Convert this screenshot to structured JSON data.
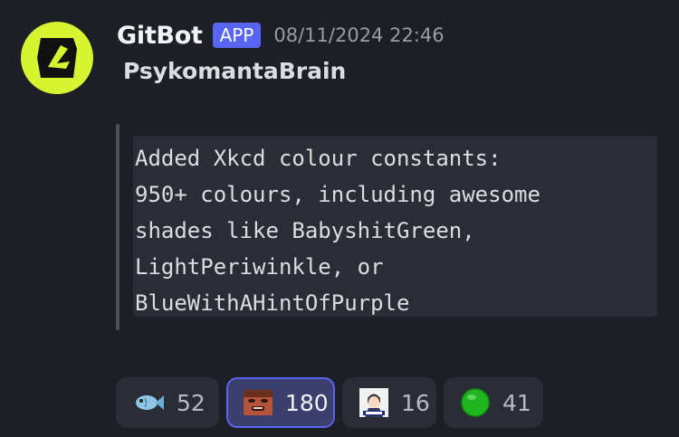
{
  "message": {
    "author": "GitBot",
    "badge": "APP",
    "timestamp": "08/11/2024 22:46",
    "repo": "PsykomantaBrain",
    "code_lines": [
      "Added Xkcd colour constants:",
      "950+ colours, including awesome",
      "shades like BabyshitGreen,",
      "LightPeriwinkle, or",
      "BlueWithAHintOfPurple"
    ]
  },
  "reactions": [
    {
      "emoji": "fish-emoji",
      "count": "52",
      "active": false
    },
    {
      "emoji": "face-emoji",
      "count": "180",
      "active": true
    },
    {
      "emoji": "anime-character-emoji",
      "count": "16",
      "active": false
    },
    {
      "emoji": "green-circle-emoji",
      "count": "41",
      "active": false
    }
  ],
  "colors": {
    "background": "#1e1f26",
    "avatar": "#d6f530",
    "badge": "#5865f2",
    "code_bg": "#2b2d36"
  }
}
